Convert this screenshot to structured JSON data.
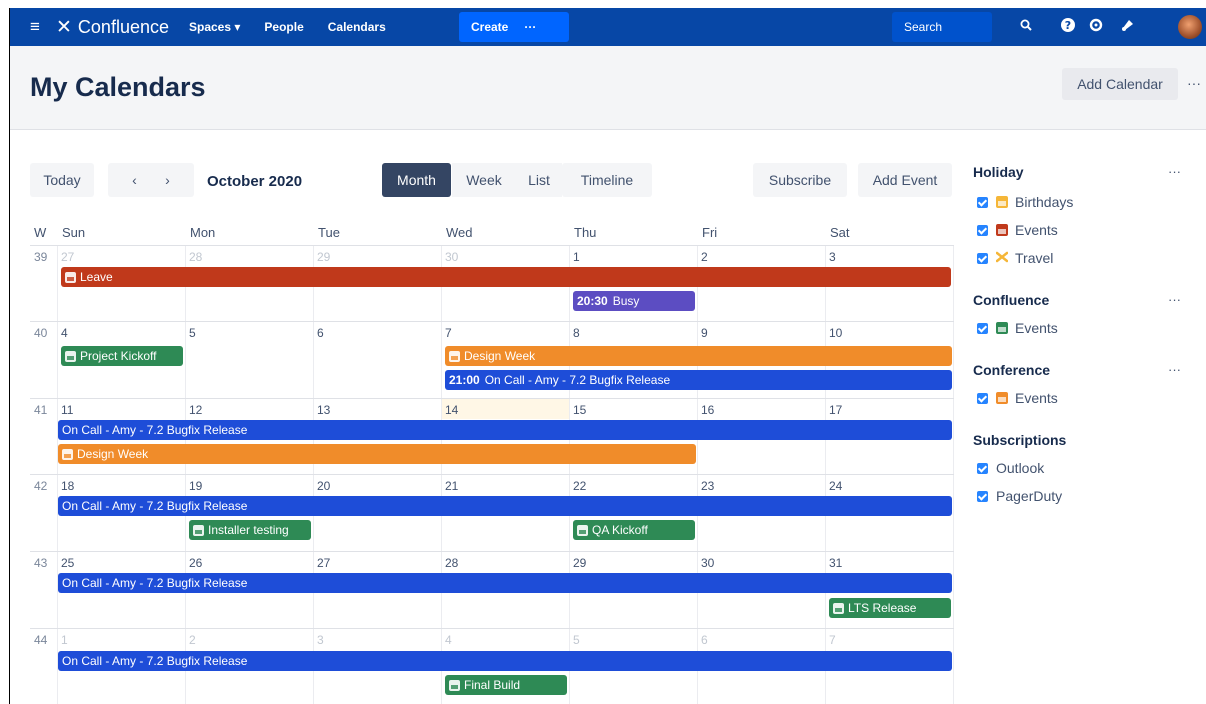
{
  "nav": {
    "brand": "Confluence",
    "spaces": "Spaces ▾",
    "people": "People",
    "calendars": "Calendars",
    "create": "Create",
    "more": "···",
    "search": "Search"
  },
  "page": {
    "title": "My Calendars",
    "add_calendar": "Add Calendar",
    "more": "···"
  },
  "toolbar": {
    "today": "Today",
    "prev": "‹",
    "next": "›",
    "month_title": "October 2020",
    "views": [
      "Month",
      "Week",
      "List",
      "Timeline"
    ],
    "active_view": "Month",
    "subscribe": "Subscribe",
    "add_event": "Add Event"
  },
  "calendar": {
    "week_header": "W",
    "day_headers": [
      "Sun",
      "Mon",
      "Tue",
      "Wed",
      "Thu",
      "Fri",
      "Sat"
    ],
    "weeks": [
      {
        "num": "39",
        "days": [
          "27",
          "28",
          "29",
          "30",
          "1",
          "2",
          "3"
        ]
      },
      {
        "num": "40",
        "days": [
          "4",
          "5",
          "6",
          "7",
          "8",
          "9",
          "10"
        ]
      },
      {
        "num": "41",
        "days": [
          "11",
          "12",
          "13",
          "14",
          "15",
          "16",
          "17"
        ]
      },
      {
        "num": "42",
        "days": [
          "18",
          "19",
          "20",
          "21",
          "22",
          "23",
          "24"
        ]
      },
      {
        "num": "43",
        "days": [
          "25",
          "26",
          "27",
          "28",
          "29",
          "30",
          "31"
        ]
      },
      {
        "num": "44",
        "days": [
          "1",
          "2",
          "3",
          "4",
          "5",
          "6",
          "7"
        ]
      }
    ],
    "events": {
      "leave": "Leave",
      "busy_time": "20:30",
      "busy": "Busy",
      "project_kickoff": "Project Kickoff",
      "design_week": "Design Week",
      "oncall_time": "21:00",
      "oncall": "On Call - Amy - 7.2 Bugfix Release",
      "installer_testing": "Installer testing",
      "qa_kickoff": "QA Kickoff",
      "lts_release": "LTS Release",
      "final_build": "Final Build"
    }
  },
  "sidebar": {
    "groups": [
      {
        "name": "Holiday",
        "more": "···",
        "items": [
          {
            "label": "Birthdays",
            "color": "#f5b638"
          },
          {
            "label": "Events",
            "color": "#c0391b"
          },
          {
            "label": "Travel",
            "color": "#f5b638"
          }
        ]
      },
      {
        "name": "Confluence",
        "more": "···",
        "items": [
          {
            "label": "Events",
            "color": "#2e8a55"
          }
        ]
      },
      {
        "name": "Conference",
        "more": "···",
        "items": [
          {
            "label": "Events",
            "color": "#f08c2a"
          }
        ]
      },
      {
        "name": "Subscriptions",
        "items": [
          {
            "label": "Outlook"
          },
          {
            "label": "PagerDuty"
          }
        ]
      }
    ]
  }
}
